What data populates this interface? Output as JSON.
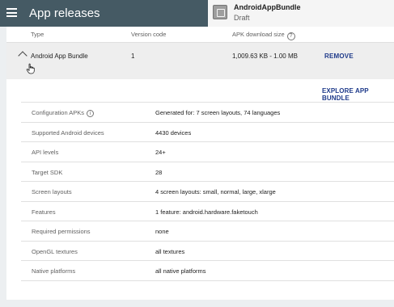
{
  "header": {
    "title": "App releases",
    "menu_icon": "menu-icon",
    "bundle": {
      "name": "AndroidAppBundle",
      "status": "Draft",
      "icon": "app-bundle-icon"
    }
  },
  "table": {
    "headers": {
      "type": "Type",
      "version_code": "Version code",
      "apk_size": "APK download size",
      "apk_size_help": "?"
    },
    "row": {
      "type": "Android App Bundle",
      "version_code": "1",
      "apk_size": "1,009.63 KB - 1.00 MB",
      "remove_label": "REMOVE"
    }
  },
  "explore_label": "EXPLORE APP BUNDLE",
  "details": [
    {
      "label": "Configuration APKs",
      "value": "Generated for: 7 screen layouts, 74 languages",
      "info": "i"
    },
    {
      "label": "Supported Android devices",
      "value": "4430 devices"
    },
    {
      "label": "API levels",
      "value": "24+"
    },
    {
      "label": "Target SDK",
      "value": "28"
    },
    {
      "label": "Screen layouts",
      "value": "4 screen layouts: small, normal, large, xlarge"
    },
    {
      "label": "Features",
      "value": "1 feature: android.hardware.faketouch"
    },
    {
      "label": "Required permissions",
      "value": "none"
    },
    {
      "label": "OpenGL textures",
      "value": "all textures"
    },
    {
      "label": "Native platforms",
      "value": "all native platforms"
    }
  ],
  "colors": {
    "topbar": "#455a64",
    "accent": "#1e3a8a",
    "background": "#eceff1"
  }
}
